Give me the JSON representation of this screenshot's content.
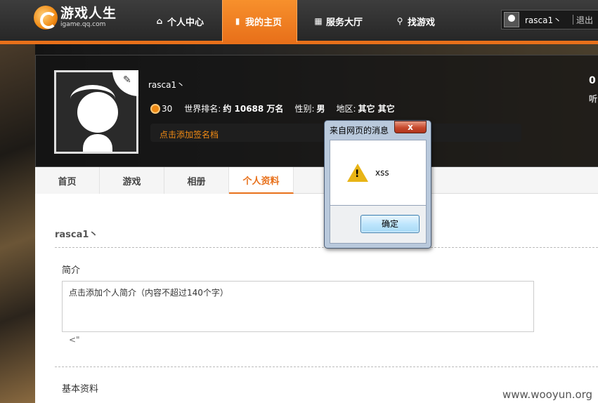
{
  "logo": {
    "name": "游戏人生",
    "domain": "igame.qq.com"
  },
  "nav": {
    "items": [
      {
        "label": "个人中心",
        "icon": "home-icon"
      },
      {
        "label": "我的主页",
        "icon": "document-icon",
        "active": true
      },
      {
        "label": "服务大厅",
        "icon": "grid-icon"
      },
      {
        "label": "找游戏",
        "icon": "search-icon"
      }
    ]
  },
  "user": {
    "name": "rasca1丶",
    "logout": "退出"
  },
  "profile": {
    "name": "rasca1丶",
    "level": "30",
    "rank_label": "世界排名:",
    "rank_value": "约 10688 万名",
    "gender_label": "性别:",
    "gender_value": "男",
    "region_label": "地区:",
    "region_value": "其它 其它",
    "signature_link": "点击添加签名档",
    "right_count": "0",
    "right_label": "听"
  },
  "tabs": [
    {
      "label": "首页"
    },
    {
      "label": "游戏"
    },
    {
      "label": "相册"
    },
    {
      "label": "个人资料",
      "active": true
    }
  ],
  "content": {
    "username": "rasca1丶",
    "intro_label": "简介",
    "intro_placeholder": "点击添加个人简介（内容不超过140个字）",
    "intro_tail": "<\"",
    "basic_label": "基本资料"
  },
  "dialog": {
    "title": "来自网页的消息",
    "close": "x",
    "message": "xss",
    "ok_label": "确定"
  },
  "watermark": "www.wooyun.org",
  "colors": {
    "accent": "#e8701a",
    "header_bg": "#2b2b2b"
  }
}
